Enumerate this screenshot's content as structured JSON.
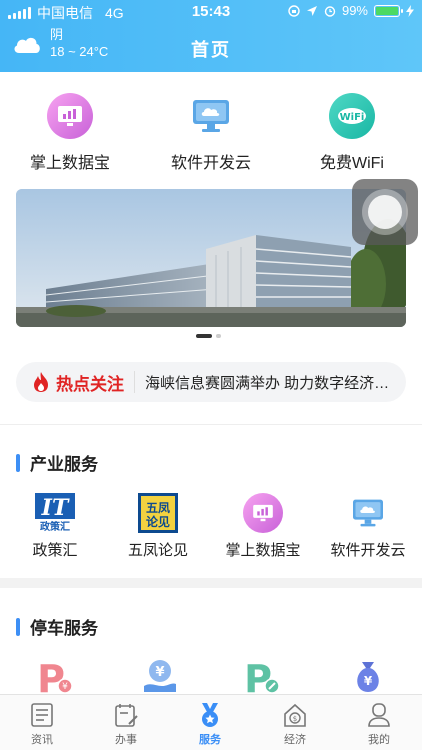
{
  "status_bar": {
    "carrier": "中国电信",
    "network": "4G",
    "time": "15:43",
    "battery": "99%",
    "battery_level": 0.99
  },
  "header": {
    "weather_condition": "阴",
    "weather_temp": "18 ~ 24°C",
    "title": "首页",
    "gradient_start": "#45b6f6",
    "gradient_end": "#5fc6f9"
  },
  "quick_items": [
    {
      "label": "掌上数据宝",
      "icon": "data-chart-icon"
    },
    {
      "label": "软件开发云",
      "icon": "cloud-monitor-icon"
    },
    {
      "label": "免费WiFi",
      "icon": "wifi-icon"
    }
  ],
  "banner": {
    "page": 1,
    "pages": 2
  },
  "hot": {
    "title": "热点关注",
    "headline": "海峡信息赛圆满举办 助力数字经济发展",
    "accent": "#e02424"
  },
  "sections": {
    "industry": {
      "title": "产业服务",
      "items": [
        {
          "label": "政策汇",
          "icon": "policy-logo-icon"
        },
        {
          "label": "五凤论见",
          "icon": "wufeng-logo-icon"
        },
        {
          "label": "掌上数据宝",
          "icon": "data-chart-icon"
        },
        {
          "label": "软件开发云",
          "icon": "cloud-monitor-icon"
        }
      ]
    },
    "parking": {
      "title": "停车服务",
      "items": [
        {
          "icon": "parking-pay-icon"
        },
        {
          "icon": "yuan-hand-icon"
        },
        {
          "icon": "parking-edit-icon"
        },
        {
          "icon": "money-bag-icon"
        }
      ]
    }
  },
  "tabs": [
    {
      "label": "资讯",
      "icon": "news-icon",
      "active": false
    },
    {
      "label": "办事",
      "icon": "task-icon",
      "active": false
    },
    {
      "label": "服务",
      "icon": "service-medal-icon",
      "active": true
    },
    {
      "label": "经济",
      "icon": "economy-house-icon",
      "active": false
    },
    {
      "label": "我的",
      "icon": "profile-icon",
      "active": false
    }
  ],
  "accent_color": "#3a8ef6"
}
